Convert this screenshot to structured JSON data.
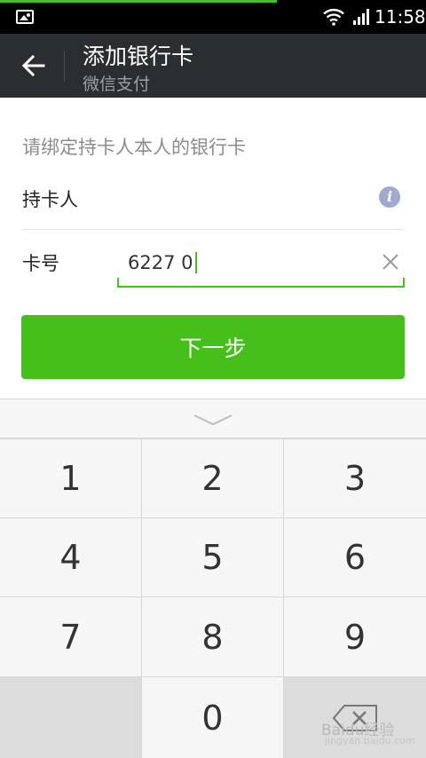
{
  "status_bar": {
    "time": "11:58",
    "icons": [
      "image-icon",
      "wifi-icon",
      "signal-icon"
    ]
  },
  "header": {
    "title": "添加银行卡",
    "subtitle": "微信支付",
    "back_icon": "back-arrow-icon"
  },
  "form": {
    "hint": "请绑定持卡人本人的银行卡",
    "holder_label": "持卡人",
    "card_label": "卡号",
    "card_value": "6227 0",
    "info_icon": "i"
  },
  "next_button": "下一步",
  "keypad": {
    "keys": [
      "1",
      "2",
      "3",
      "4",
      "5",
      "6",
      "7",
      "8",
      "9",
      "0"
    ]
  },
  "watermark": {
    "text": "Baidu经验",
    "sub": "jingyan.baidu.com"
  },
  "colors": {
    "accent": "#45c01a",
    "header_bg": "#2a2e31",
    "status_bg": "#000000"
  }
}
